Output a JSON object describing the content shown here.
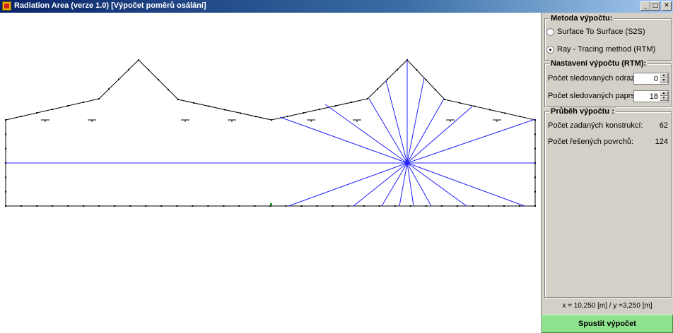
{
  "window": {
    "title": "Radiation Area (verze 1.0) [Výpočet poměrů osálání]",
    "minimize_glyph": "_",
    "maximize_glyph": "□",
    "close_glyph": "✕"
  },
  "method": {
    "title": "Metoda výpočtu:",
    "options": [
      {
        "label": "Surface To Surface (S2S)",
        "checked": false
      },
      {
        "label": "Ray - Tracing method (RTM)",
        "checked": true
      }
    ]
  },
  "settings": {
    "title": "Nastavení výpočtu (RTM):",
    "reflections_label": "Počet sledovaných odrazů:",
    "reflections_value": "0",
    "rays_label": "Počet sledovaných paprsků:",
    "rays_value": "18"
  },
  "progress": {
    "title": "Průběh výpočtu :",
    "constructions_label": "Počet zadaných konstrukcí:",
    "constructions_value": "62",
    "surfaces_label": "Počet řešených povrchů:",
    "surfaces_value": "124"
  },
  "status": {
    "coordinates": "x = 10,250 [m]  /  y =3,250 [m]"
  },
  "run_button_label": "Spustit výpočet",
  "colors": {
    "ray": "#2020ff",
    "construction": "#000000",
    "run_button": "#8ee28e"
  }
}
